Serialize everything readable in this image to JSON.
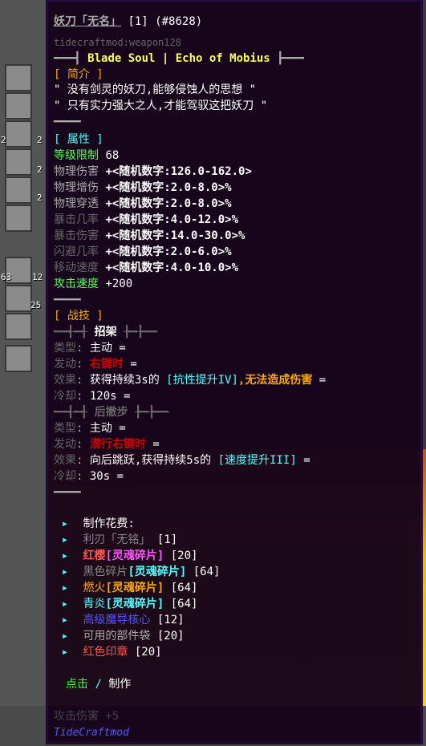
{
  "tooltip": {
    "title": "妖刀「无名」",
    "title_count": "[1]",
    "title_id": "(#8628)",
    "registry_id": "tidecraftmod:weapon128",
    "series_left": "━━━┫",
    "series_name": "Blade Soul | Echo of Mobius",
    "series_right": "┣━━━",
    "intro_header": "[ 简介 ]",
    "intro_lines": [
      "\" 没有剑灵的妖刀,能够侵蚀人的思想 \"",
      "\" 只有实力强大之人,才能驾驭这把妖刀 \""
    ],
    "divider": "━━━━",
    "attr_header": "[ 属性 ]",
    "level_label": "等级限制",
    "level_value": "68",
    "attributes": [
      {
        "name": "物理伤害",
        "value": "+<随机数字:126.0-162.0>"
      },
      {
        "name": "物理增伤",
        "value": "+<随机数字:2.0-8.0>%"
      },
      {
        "name": "物理穿透",
        "value": "+<随机数字:2.0-8.0>%"
      },
      {
        "name": "暴击几率",
        "value": "+<随机数字:4.0-12.0>%"
      },
      {
        "name": "暴击伤害",
        "value": "+<随机数字:14.0-30.0>%"
      },
      {
        "name": "闪避几率",
        "value": "+<随机数字:2.0-6.0>%"
      },
      {
        "name": "移动速度",
        "value": "+<随机数字:4.0-10.0>%"
      }
    ],
    "attack_speed_label": "攻击速度",
    "attack_speed_value": "+200",
    "skills_header": "[ 战技 ]",
    "skill1": {
      "name": "招架",
      "deco_left": "━━┫━┫",
      "deco_right": "┣━┣━━",
      "type_label": "类型",
      "type_value": "主动 =",
      "trigger_label": "发动",
      "trigger_value": "右键时",
      "trigger_suffix": "=",
      "effect_label": "效果",
      "effect_pre": "获得持续3s的",
      "effect_buff": "[抗性提升IV]",
      "effect_mid": ",无法造成伤害",
      "effect_suffix": "=",
      "cooldown_label": "冷却",
      "cooldown_value": "120s ="
    },
    "skill2": {
      "name": "后撤步",
      "deco_left": "━━┫━┫",
      "deco_right": "┣━┣━━",
      "type_label": "类型",
      "type_value": "主动 =",
      "trigger_label": "发动",
      "trigger_value": "潜行右键时",
      "trigger_suffix": "=",
      "effect_label": "效果",
      "effect_pre": "向后跳跃,获得持续5s的",
      "effect_buff": "[速度提升III]",
      "effect_suffix": "=",
      "cooldown_label": "冷却",
      "cooldown_value": "30s ="
    },
    "craft_header": "制作花费:",
    "craft_items": [
      {
        "name": "利刃「无铭」",
        "suffix": "",
        "count": "[1]",
        "color": "#888888",
        "suffix_color": "#888888"
      },
      {
        "name": "红樱",
        "suffix": "[灵魂碎片]",
        "count": "[20]",
        "color": "#ff5555",
        "suffix_color": "#ff55ff"
      },
      {
        "name": "黑色碎片",
        "suffix": "[灵魂碎片]",
        "count": "[64]",
        "color": "#888888",
        "suffix_color": "#55ffff"
      },
      {
        "name": "燃火",
        "suffix": "[灵魂碎片]",
        "count": "[64]",
        "color": "#ffaa00",
        "suffix_color": "#ffaa00"
      },
      {
        "name": "青炎",
        "suffix": "[灵魂碎片]",
        "count": "[64]",
        "color": "#55ffff",
        "suffix_color": "#55ffff"
      },
      {
        "name": "高级魔导核心",
        "suffix": "",
        "count": "[12]",
        "color": "#5555ff",
        "suffix_color": "#5555ff"
      },
      {
        "name": "可用的部件袋",
        "suffix": "",
        "count": "[20]",
        "color": "#aaaaaa",
        "suffix_color": "#aaaaaa"
      },
      {
        "name": "红色印章",
        "suffix": "",
        "count": "[20]",
        "color": "#ff5555",
        "suffix_color": "#ff5555"
      }
    ],
    "action_click": "点击",
    "action_sep": "/",
    "action_craft": "制作",
    "footer_overlap": "攻击伤害 +5",
    "mod_name": "TideCraftmod"
  },
  "inventory": {
    "counts": [
      "2",
      "2",
      "2",
      "2",
      "63",
      "12",
      "25"
    ]
  }
}
